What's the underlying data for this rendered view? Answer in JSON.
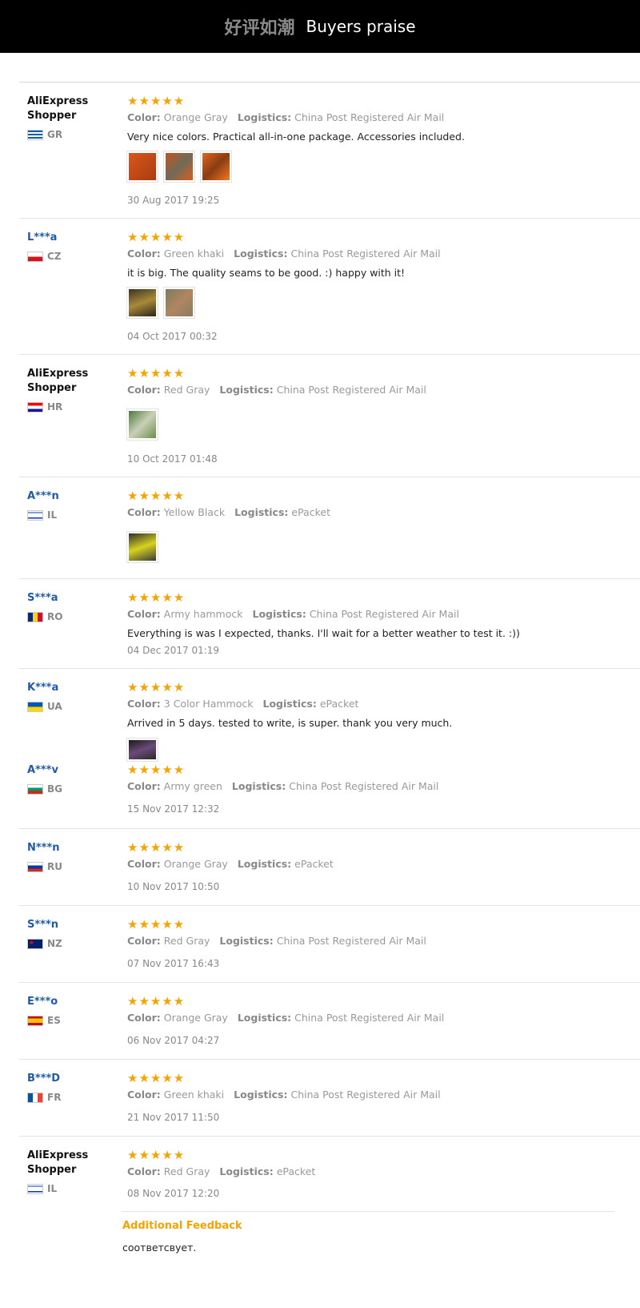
{
  "banner": {
    "chinese": "好评如潮",
    "english": "Buyers praise"
  },
  "labels": {
    "color": "Color:",
    "logistics": "Logistics:",
    "additional_feedback": "Additional Feedback"
  },
  "stars": "★★★★★",
  "reviews": [
    {
      "name_line1": "AliExpress",
      "name_line2": "Shopper",
      "country": "GR",
      "color": "Orange Gray",
      "logistics": "China Post Registered Air Mail",
      "text": "Very nice colors. Practical all-in-one package. Accessories included.",
      "date": "30 Aug 2017 19:25"
    },
    {
      "name": "L***a",
      "country": "CZ",
      "color": "Green khaki",
      "logistics": "China Post Registered Air Mail",
      "text": "it is big. The quality seams to be good. :) happy with it!",
      "date": "04 Oct 2017 00:32"
    },
    {
      "name_line1": "AliExpress",
      "name_line2": "Shopper",
      "country": "HR",
      "color": "Red Gray",
      "logistics": "China Post Registered Air Mail",
      "date": "10 Oct 2017 01:48"
    },
    {
      "name": "A***n",
      "country": "IL",
      "color": "Yellow Black",
      "logistics": "ePacket"
    },
    {
      "name": "S***a",
      "country": "RO",
      "color": "Army hammock",
      "logistics": "China Post Registered Air Mail",
      "text": "Everything is was I expected, thanks. I'll wait for a better weather to test it. :))",
      "date": "04 Dec 2017 01:19"
    },
    {
      "name": "K***a",
      "country": "UA",
      "color": "3 Color Hammock",
      "logistics": "ePacket",
      "text": "Arrived in 5 days. tested to write, is super. thank you very much."
    },
    {
      "name": "A***v",
      "country": "BG",
      "color": "Army green",
      "logistics": "China Post Registered Air Mail",
      "date": "15 Nov 2017 12:32"
    },
    {
      "name": "N***n",
      "country": "RU",
      "color": "Orange Gray",
      "logistics": "ePacket",
      "date": "10 Nov 2017 10:50"
    },
    {
      "name": "S***n",
      "country": "NZ",
      "color": "Red Gray",
      "logistics": "China Post Registered Air Mail",
      "date": "07 Nov 2017 16:43"
    },
    {
      "name": "E***o",
      "country": "ES",
      "color": "Orange Gray",
      "logistics": "China Post Registered Air Mail",
      "date": "06 Nov 2017 04:27"
    },
    {
      "name": "B***D",
      "country": "FR",
      "color": "Green khaki",
      "logistics": "China Post Registered Air Mail",
      "date": "21 Nov 2017 11:50"
    },
    {
      "name_line1": "AliExpress",
      "name_line2": "Shopper",
      "country": "IL",
      "color": "Red Gray",
      "logistics": "ePacket",
      "date": "08 Nov 2017 12:20",
      "additional_feedback": "соответсвует."
    }
  ]
}
